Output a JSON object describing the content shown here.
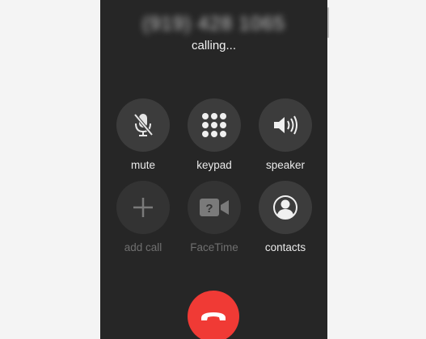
{
  "call": {
    "number": "(919) 428 1065",
    "status": "calling..."
  },
  "controls": {
    "mute": {
      "label": "mute",
      "icon": "microphone-muted-icon",
      "enabled": true
    },
    "keypad": {
      "label": "keypad",
      "icon": "keypad-icon",
      "enabled": true
    },
    "speaker": {
      "label": "speaker",
      "icon": "speaker-icon",
      "enabled": true
    },
    "add_call": {
      "label": "add call",
      "icon": "plus-icon",
      "enabled": false
    },
    "facetime": {
      "label": "FaceTime",
      "icon": "facetime-video-icon",
      "enabled": false
    },
    "contacts": {
      "label": "contacts",
      "icon": "contacts-person-icon",
      "enabled": true
    }
  },
  "end_call": {
    "icon": "phone-hangup-icon"
  },
  "colors": {
    "background": "#262626",
    "button": "#3c3c3c",
    "end_call": "#f03a35",
    "text": "#eaeaea",
    "disabled_text": "#6f6f6f"
  }
}
